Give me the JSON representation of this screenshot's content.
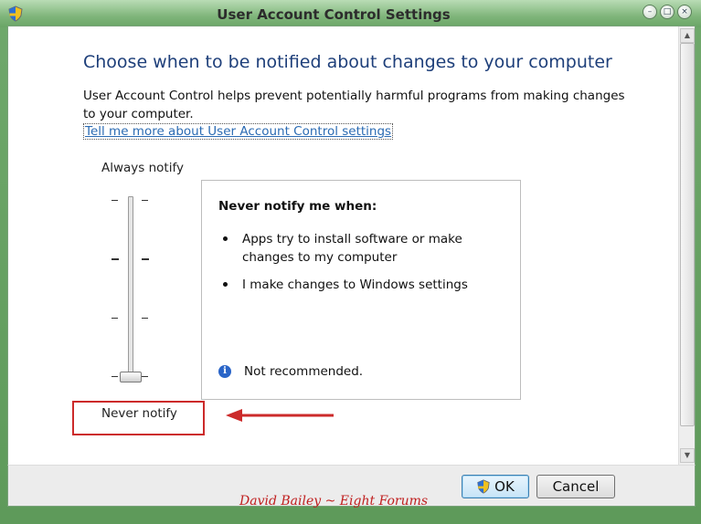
{
  "window": {
    "title": "User Account Control Settings"
  },
  "main": {
    "heading": "Choose when to be notified about changes to your computer",
    "description": "User Account Control helps prevent potentially harmful programs from making changes to your computer.",
    "link_text": "Tell me more about User Account Control settings"
  },
  "slider": {
    "top_label": "Always notify",
    "bottom_label": "Never notify",
    "level": 0,
    "levels": 4
  },
  "info_panel": {
    "heading": "Never notify me when:",
    "bullets": [
      "Apps try to install software or make changes to my computer",
      "I make changes to Windows settings"
    ],
    "warning": "Not recommended."
  },
  "buttons": {
    "ok": "OK",
    "cancel": "Cancel"
  },
  "watermark": "David Bailey ~ Eight Forums",
  "colors": {
    "heading": "#1e3f7a",
    "link": "#2b6bb3",
    "annotation": "#cc2a2a",
    "frame": "#6aa566"
  },
  "icons": {
    "app": "shield-icon",
    "info": "info-icon",
    "ok": "uac-shield-icon"
  }
}
